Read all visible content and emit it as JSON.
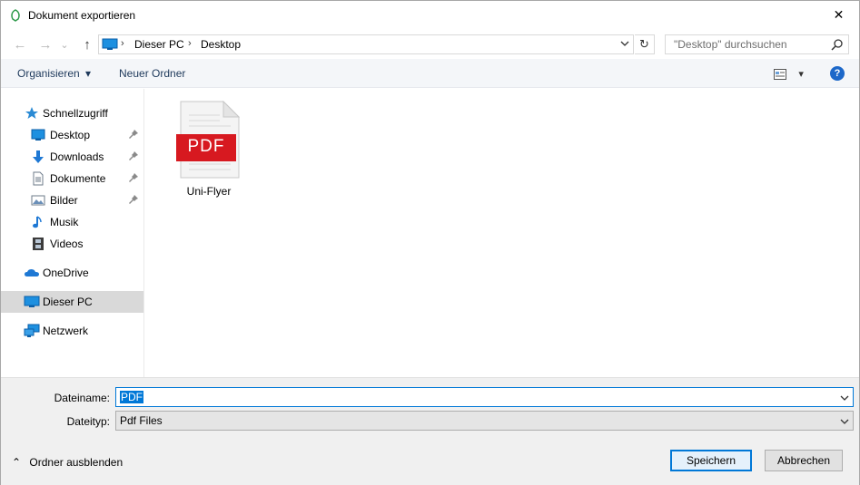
{
  "window": {
    "title": "Dokument exportieren",
    "close_glyph": "✕"
  },
  "nav": {
    "back_glyph": "←",
    "forward_glyph": "→",
    "recent_glyph": "⌄",
    "up_glyph": "↑",
    "breadcrumb": [
      "Dieser PC",
      "Desktop"
    ],
    "separator_glyph": "›",
    "refresh_glyph": "↻",
    "search_placeholder": "\"Desktop\" durchsuchen"
  },
  "commands": {
    "organize": "Organisieren",
    "organize_arrow": "▾",
    "new_folder": "Neuer Ordner",
    "view_arrow": "▾",
    "help": "?"
  },
  "sidebar": {
    "items": [
      {
        "label": "Schnellzugriff",
        "icon": "star-icon",
        "pinned": false
      },
      {
        "label": "Desktop",
        "icon": "desktop-icon",
        "pinned": true
      },
      {
        "label": "Downloads",
        "icon": "download-arrow-icon",
        "pinned": true
      },
      {
        "label": "Dokumente",
        "icon": "document-icon",
        "pinned": true
      },
      {
        "label": "Bilder",
        "icon": "pictures-icon",
        "pinned": true
      },
      {
        "label": "Musik",
        "icon": "music-note-icon",
        "pinned": false
      },
      {
        "label": "Videos",
        "icon": "film-icon",
        "pinned": false
      },
      {
        "label": "OneDrive",
        "icon": "cloud-icon",
        "pinned": false
      },
      {
        "label": "Dieser PC",
        "icon": "computer-icon",
        "pinned": false,
        "selected": true
      },
      {
        "label": "Netzwerk",
        "icon": "network-icon",
        "pinned": false
      }
    ],
    "pin_glyph": "📌"
  },
  "files": [
    {
      "name": "Uni-Flyer",
      "type_badge": "PDF"
    }
  ],
  "save_form": {
    "filename_label": "Dateiname:",
    "filename_value": "PDF",
    "filetype_label": "Dateityp:",
    "filetype_value": "Pdf Files"
  },
  "footer": {
    "hide_folders_glyph": "⌃",
    "hide_folders": "Ordner ausblenden",
    "save": "Speichern",
    "cancel": "Abbrechen"
  },
  "colors": {
    "accent": "#0078d7",
    "pdf_red": "#d71920",
    "selection_bg": "#d9d9d9",
    "link_text": "#1e395b"
  }
}
